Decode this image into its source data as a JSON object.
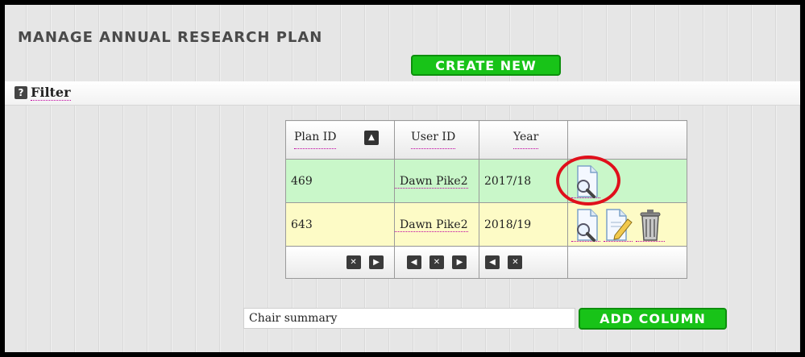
{
  "page": {
    "title": "MANAGE ANNUAL RESEARCH PLAN",
    "create_label": "CREATE NEW"
  },
  "filter": {
    "help_glyph": "?",
    "label": "Filter"
  },
  "table": {
    "headers": [
      "Plan ID",
      "User ID",
      "Year",
      ""
    ],
    "rows": [
      {
        "plan_id": "469",
        "user_id": "Dawn Pike2",
        "year": "2017/18",
        "actions": [
          "view-document-icon"
        ]
      },
      {
        "plan_id": "643",
        "user_id": "Dawn Pike2",
        "year": "2018/19",
        "actions": [
          "view-document-icon",
          "edit-document-icon",
          "trash-icon"
        ]
      }
    ],
    "sort_glyph": "▲",
    "footer": {
      "col1": [
        "✕",
        "▶"
      ],
      "col2": [
        "◀",
        "✕",
        "▶"
      ],
      "col3": [
        "◀",
        "✕"
      ]
    }
  },
  "add_column": {
    "input_value": "Chair summary",
    "button_label": "ADD COLUMN"
  },
  "colors": {
    "accent_green": "#18c318",
    "row_green": "#c9f7c9",
    "row_yellow": "#fdfbc6",
    "highlight_red": "#e0101b"
  }
}
